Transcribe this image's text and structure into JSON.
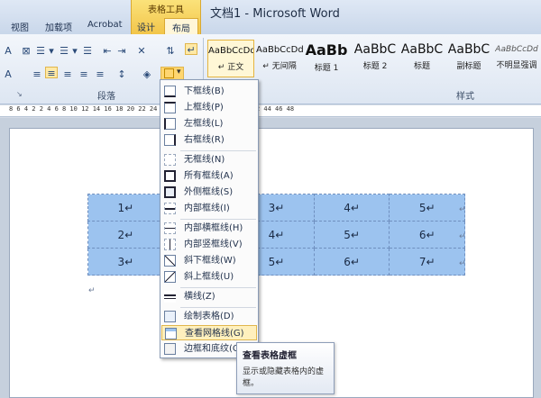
{
  "title": "文档1 - Microsoft Word",
  "context_group": "表格工具",
  "tabs": [
    "视图",
    "加载项",
    "Acrobat",
    "设计",
    "布局"
  ],
  "ribbon": {
    "group_paragraph": "段落",
    "group_styles": "样式",
    "styles": [
      {
        "sample": "AaBbCcDd",
        "name": "↵ 正文"
      },
      {
        "sample": "AaBbCcDd",
        "name": "↵ 无间隔"
      },
      {
        "sample": "AaBb",
        "name": "标题 1"
      },
      {
        "sample": "AaBbC",
        "name": "标题 2"
      },
      {
        "sample": "AaBbC",
        "name": "标题"
      },
      {
        "sample": "AaBbC",
        "name": "副标题"
      },
      {
        "sample": "AaBbCcDd",
        "name": "不明显强调"
      }
    ]
  },
  "ruler": "8   6   4   2      2   4   6   8   10   12   14   16   18   20   22   24   26   28   30   32   34   36   38   40   42   44   46   48",
  "table": {
    "rows": [
      [
        "1↵",
        "",
        "3↵",
        "4↵",
        "5↵"
      ],
      [
        "2↵",
        "",
        "4↵",
        "5↵",
        "6↵"
      ],
      [
        "3↵",
        "",
        "5↵",
        "6↵",
        "7↵"
      ]
    ],
    "row_end": "↵"
  },
  "para_mark": "↵",
  "menu": [
    {
      "label": "下框线(B)",
      "icon": "bottom-border-icon"
    },
    {
      "label": "上框线(P)",
      "icon": "top-border-icon"
    },
    {
      "label": "左框线(L)",
      "icon": "left-border-icon"
    },
    {
      "label": "右框线(R)",
      "icon": "right-border-icon"
    },
    {
      "label": "无框线(N)",
      "icon": "no-border-icon"
    },
    {
      "label": "所有框线(A)",
      "icon": "all-borders-icon"
    },
    {
      "label": "外侧框线(S)",
      "icon": "outside-borders-icon"
    },
    {
      "label": "内部框线(I)",
      "icon": "inside-borders-icon"
    },
    {
      "label": "内部横框线(H)",
      "icon": "inside-horizontal-icon"
    },
    {
      "label": "内部竖框线(V)",
      "icon": "inside-vertical-icon"
    },
    {
      "label": "斜下框线(W)",
      "icon": "diagonal-down-icon"
    },
    {
      "label": "斜上框线(U)",
      "icon": "diagonal-up-icon"
    },
    {
      "label": "横线(Z)",
      "icon": "horizontal-line-icon"
    },
    {
      "label": "绘制表格(D)",
      "icon": "draw-table-icon"
    },
    {
      "label": "查看网格线(G)",
      "icon": "view-gridlines-icon"
    },
    {
      "label": "边框和底纹(O)...",
      "icon": "borders-shading-icon"
    }
  ],
  "tooltip": {
    "title": "查看表格虚框",
    "body": "显示或隐藏表格内的虚框。"
  }
}
